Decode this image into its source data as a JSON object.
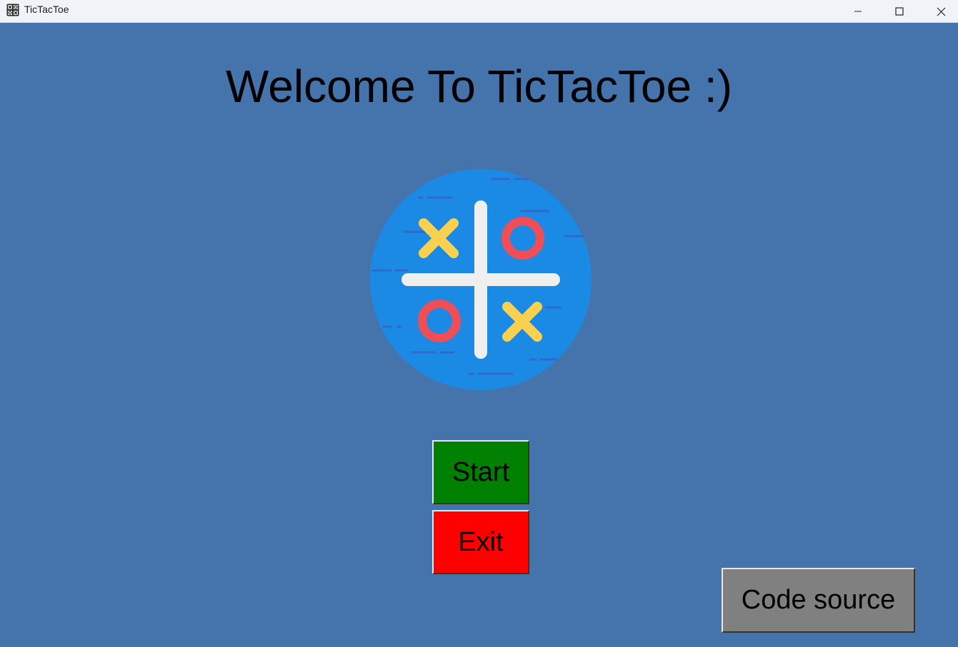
{
  "window": {
    "title": "TicTacToe",
    "app_icon": "tictactoe-grid-icon",
    "controls": [
      "minimize-icon",
      "maximize-icon",
      "close-icon"
    ]
  },
  "main": {
    "heading": "Welcome To TicTacToe :)",
    "logo_icon": "tictactoe-logo-icon",
    "buttons": {
      "start_label": "Start",
      "exit_label": "Exit",
      "code_source_label": "Code source"
    }
  },
  "colors": {
    "background": "#4573ab",
    "titlebar": "#f0f4f9",
    "logo_circle": "#1a8ae5",
    "logo_x": "#f9d14f",
    "logo_o": "#ef4e57",
    "start_button": "#008000",
    "exit_button": "#ff0000",
    "code_source_button": "#808080"
  }
}
